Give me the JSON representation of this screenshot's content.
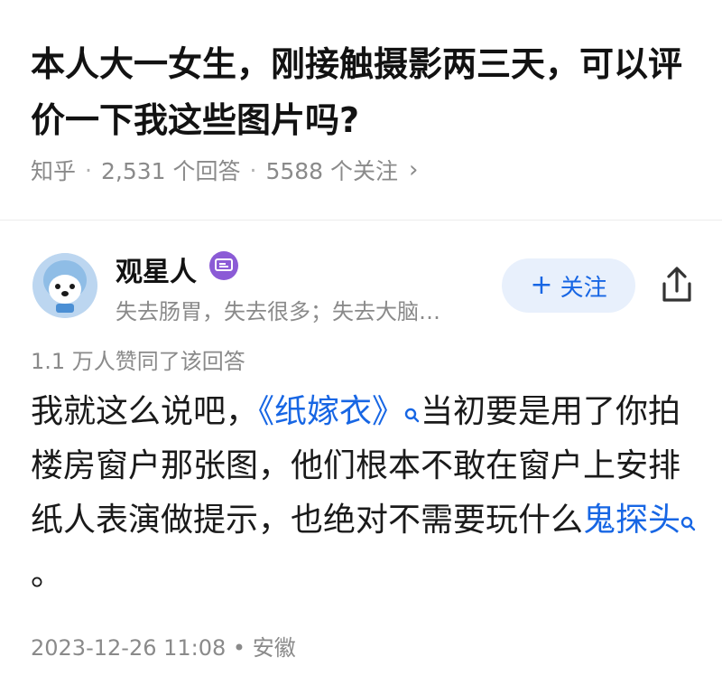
{
  "question": {
    "title": "本人大一女生，刚接触摄影两三天，可以评价一下我这些图片吗?",
    "source": "知乎",
    "answers_count": "2,531 个回答",
    "followers_count": "5588 个关注",
    "separator": "·",
    "chevron": "›"
  },
  "author": {
    "name": "观星人",
    "bio": "失去肠胃，失去很多；失去大脑…",
    "follow_plus": "+",
    "follow_label": "关注",
    "badge_icon": "verified-badge-icon",
    "badge_color": "#8b5bd6"
  },
  "answer": {
    "likes": "1.1 万人赞同了该回答",
    "text_1": "我就这么说吧，",
    "link_1": "《纸嫁衣》",
    "text_2": "当初要是用了你拍楼房窗户那张图，他们根本不敢在窗户上安排纸人表演做提示，也绝对不需要玩什么",
    "link_2": "鬼探头",
    "text_3": "。",
    "datetime": "2023-12-26 11:08",
    "location_sep": "•",
    "location": "安徽"
  },
  "colors": {
    "accent": "#1766e4",
    "muted": "#8a8a8a",
    "follow_bg": "#e8f0fc"
  }
}
